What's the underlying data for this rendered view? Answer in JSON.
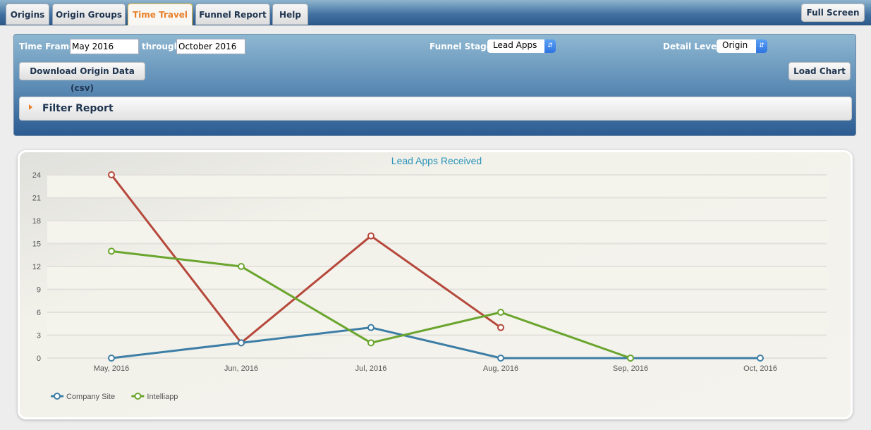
{
  "tabs": [
    {
      "label": "Origins",
      "active": false
    },
    {
      "label": "Origin Groups",
      "active": false
    },
    {
      "label": "Time Travel",
      "active": true
    },
    {
      "label": "Funnel Report",
      "active": false
    },
    {
      "label": "Help",
      "active": false
    }
  ],
  "full_screen_label": "Full Screen",
  "controls": {
    "time_frame_label": "Time Frame",
    "time_frame_start": "May 2016",
    "through_label": "through",
    "time_frame_end": "October 2016",
    "funnel_stage_label": "Funnel Stage:",
    "funnel_stage_value": "Lead Apps",
    "detail_level_label": "Detail Level:",
    "detail_level_value": "Origin",
    "download_label": "Download Origin Data (csv)",
    "load_chart_label": "Load Chart",
    "filter_label": "Filter Report"
  },
  "chart_data": {
    "type": "line",
    "title": "Lead Apps Received",
    "xlabel": "",
    "ylabel": "",
    "categories": [
      "May, 2016",
      "Jun, 2016",
      "Jul, 2016",
      "Aug, 2016",
      "Sep, 2016",
      "Oct, 2016"
    ],
    "yticks": [
      0,
      3,
      6,
      9,
      12,
      15,
      18,
      21,
      24
    ],
    "ylim": [
      0,
      24
    ],
    "grid": true,
    "legend_position": "bottom-left",
    "series": [
      {
        "name": "",
        "color": "#b5483b",
        "values": [
          24,
          2,
          16,
          4,
          null,
          null
        ],
        "in_legend": false
      },
      {
        "name": "Company Site",
        "color": "#3d7ea6",
        "values": [
          0,
          2,
          4,
          0,
          0,
          0
        ],
        "in_legend": true
      },
      {
        "name": "Intelliapp",
        "color": "#6aa52e",
        "values": [
          14,
          12,
          2,
          6,
          0,
          null
        ],
        "in_legend": true
      }
    ]
  }
}
